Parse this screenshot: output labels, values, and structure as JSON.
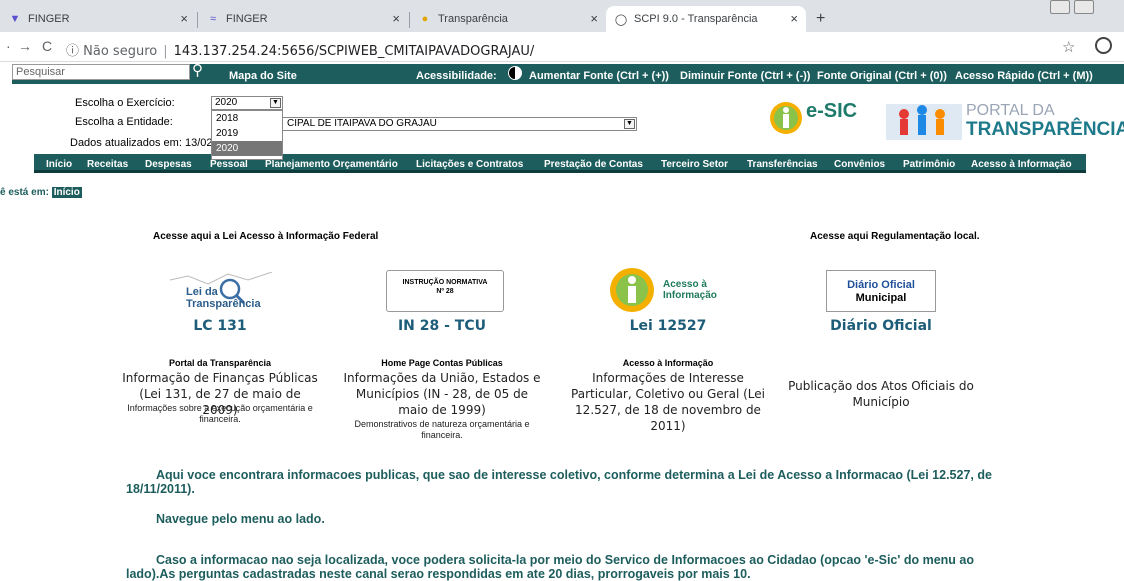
{
  "browser": {
    "tabs": [
      {
        "title": "FINGER"
      },
      {
        "title": "FINGER"
      },
      {
        "title": "Transparência"
      },
      {
        "title": "SCPI 9.0 - Transparência"
      }
    ],
    "url_security": "Não seguro",
    "url": "143.137.254.24:5656/SCPIWEB_CMITAIPAVADOGRAJAU/"
  },
  "topbar": {
    "search_placeholder": "Pesquisar",
    "sitemap": "Mapa do Site",
    "accessibility": "Acessibilidade:",
    "increase_font": "Aumentar Fonte (Ctrl + (+))",
    "decrease_font": "Diminuir Fonte (Ctrl + (-))",
    "original_font": "Fonte Original (Ctrl + (0))",
    "quick_access": "Acesso Rápido (Ctrl + (M))"
  },
  "filters": {
    "year_label": "Escolha o Exercício:",
    "year_value": "2020",
    "entity_label": "Escolha a Entidade:",
    "entity_value": "CIPAL DE ITAIPAVA DO GRAJAU",
    "updated_label": "Dados atualizados em: 13/02",
    "year_options": [
      "2018",
      "2019",
      "2020"
    ]
  },
  "logos": {
    "esic": "e-SIC",
    "portal_line1": "PORTAL DA",
    "portal_line2": "TRANSPARÊNCIA"
  },
  "menu": [
    "Início",
    "Receitas",
    "Despesas",
    "Pessoal",
    "Planejamento Orçamentário",
    "Licitações e Contratos",
    "Prestação de Contas",
    "Terceiro Setor",
    "Transferências",
    "Convênios",
    "Patrimônio",
    "Acesso à Informação"
  ],
  "breadcrumb": {
    "prefix": "ê está em:",
    "current": "Início"
  },
  "sections": {
    "federal": "Acesse aqui a Lei Acesso à Informação Federal",
    "local": "Acesse aqui Regulamentação local."
  },
  "cards": [
    {
      "logo_l1": "Lei da",
      "logo_l2": "Transparência",
      "title": "LC 131",
      "head": "Portal da Transparência",
      "desc": "Informação de Finanças Públicas (Lei 131, de 27 de maio de 2009)",
      "small": "Informações sobre a execução orçamentária e financeira."
    },
    {
      "logo_l1": "INSTRUÇÃO NORMATIVA",
      "logo_l2": "Nº 28",
      "title": "IN 28 - TCU",
      "head": "Home Page Contas Públicas",
      "desc": "Informações da União, Estados e Municípios (IN - 28, de 05 de maio de 1999)",
      "small": "Demonstrativos de natureza orçamentária e financeira."
    },
    {
      "logo_l1": "Acesso à",
      "logo_l2": "Informação",
      "title": "Lei 12527",
      "head": "Acesso à Informação",
      "desc": "Informações de Interesse Particular, Coletivo ou Geral (Lei 12.527, de 18 de novembro de 2011)",
      "small": ""
    },
    {
      "logo_l1": "Diário Oficial",
      "logo_l2": "Municipal",
      "title": "Diário Oficial",
      "head": "",
      "desc": "Publicação dos Atos Oficiais do Município",
      "small": ""
    }
  ],
  "paragraphs": [
    "Aqui voce encontrara informacoes publicas, que sao de interesse coletivo, conforme determina a Lei de Acesso a Informacao (Lei 12.527, de 18/11/2011).",
    "Navegue pelo menu ao lado.",
    "Caso a informacao nao seja localizada, voce podera solicita-la por meio do Servico de Informacoes ao Cidadao (opcao 'e-Sic' do menu ao lado).As perguntas cadastradas neste canal serao respondidas em ate 20 dias, prorrogaveis por mais 10."
  ]
}
